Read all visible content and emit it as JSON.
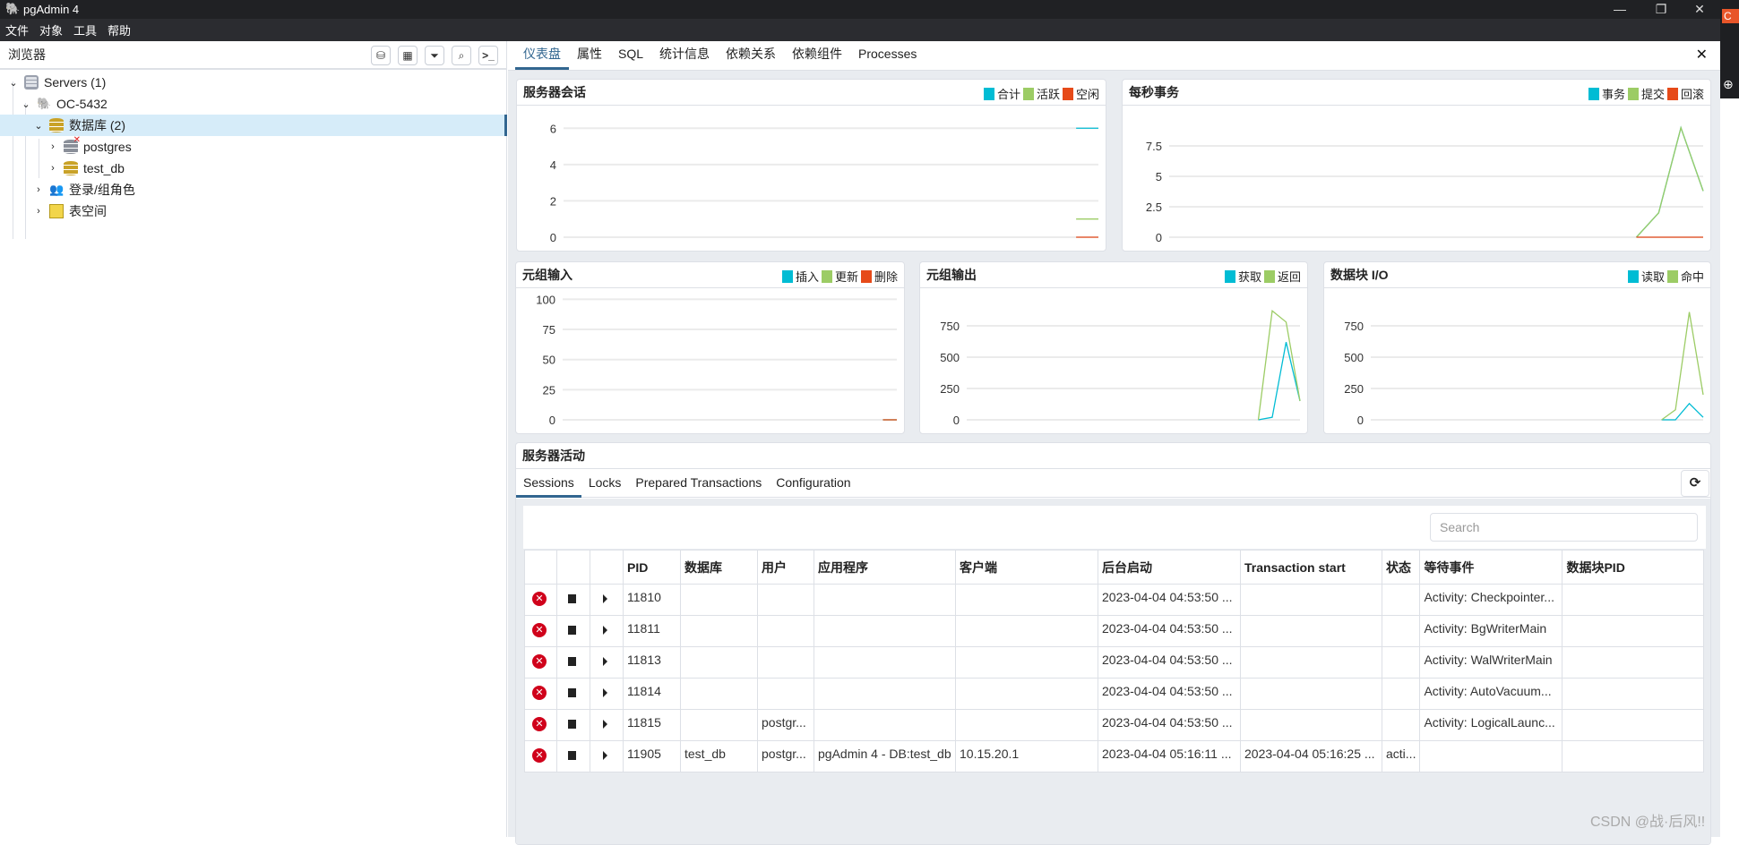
{
  "window": {
    "title": "pgAdmin 4",
    "minimize": "—",
    "maximize": "❐",
    "close": "✕"
  },
  "menu": [
    "文件",
    "对象",
    "工具",
    "帮助"
  ],
  "browser": {
    "title": "浏览器",
    "toolbar": [
      "query-tool",
      "view-data",
      "filtered-rows",
      "search-objects",
      "psql-tool"
    ],
    "tree": [
      {
        "label": "Servers (1)",
        "level": 0,
        "expanded": true,
        "icon": "servers-icon"
      },
      {
        "label": "OC-5432",
        "level": 1,
        "expanded": true,
        "icon": "elephant-icon"
      },
      {
        "label": "数据库 (2)",
        "level": 2,
        "expanded": true,
        "selected": true,
        "icon": "database-icon"
      },
      {
        "label": "postgres",
        "level": 3,
        "expanded": false,
        "icon": "database-disconnected-icon"
      },
      {
        "label": "test_db",
        "level": 3,
        "expanded": false,
        "icon": "database-icon"
      },
      {
        "label": "登录/组角色",
        "level": 2,
        "expanded": false,
        "icon": "roles-icon"
      },
      {
        "label": "表空间",
        "level": 2,
        "expanded": false,
        "icon": "tablespace-icon"
      }
    ]
  },
  "tabs": [
    "仪表盘",
    "属性",
    "SQL",
    "统计信息",
    "依赖关系",
    "依赖组件",
    "Processes"
  ],
  "active_tab": "仪表盘",
  "colors": {
    "cyan": "#00bcd4",
    "green": "#9ccc65",
    "red": "#e64a19",
    "accent": "#326690"
  },
  "chart_data": [
    {
      "type": "line",
      "title": "服务器会话",
      "xlim": [
        0,
        24
      ],
      "ylim": [
        0,
        6.9
      ],
      "yticks": [
        0,
        2,
        4,
        6
      ],
      "grid": true,
      "legend": "top-right",
      "x": [
        23,
        24
      ],
      "series": [
        {
          "name": "合计",
          "color": "#00bcd4",
          "values": [
            6,
            6
          ]
        },
        {
          "name": "活跃",
          "color": "#9ccc65",
          "values": [
            1,
            1
          ]
        },
        {
          "name": "空闲",
          "color": "#e64a19",
          "values": [
            0,
            0
          ]
        }
      ]
    },
    {
      "type": "line",
      "title": "每秒事务",
      "xlim": [
        0,
        24
      ],
      "ylim": [
        0,
        10.3
      ],
      "yticks": [
        0,
        2.5,
        5,
        7.5
      ],
      "grid": true,
      "legend": "top-right",
      "x": [
        21,
        22,
        23,
        24
      ],
      "series": [
        {
          "name": "事务",
          "color": "#00bcd4",
          "values": [
            0,
            2,
            9,
            3.8
          ]
        },
        {
          "name": "提交",
          "color": "#9ccc65",
          "values": [
            0,
            2,
            9,
            3.8
          ]
        },
        {
          "name": "回滚",
          "color": "#e64a19",
          "values": [
            0,
            0,
            0,
            0
          ]
        }
      ]
    },
    {
      "type": "line",
      "title": "元组输入",
      "xlim": [
        0,
        24
      ],
      "ylim": [
        0,
        104
      ],
      "yticks": [
        0,
        25,
        50,
        75,
        100
      ],
      "grid": true,
      "legend": "top-right",
      "x": [
        23,
        24
      ],
      "series": [
        {
          "name": "插入",
          "color": "#00bcd4",
          "values": [
            0,
            0
          ]
        },
        {
          "name": "更新",
          "color": "#9ccc65",
          "values": [
            0,
            0
          ]
        },
        {
          "name": "删除",
          "color": "#e64a19",
          "values": [
            0,
            0
          ]
        }
      ]
    },
    {
      "type": "line",
      "title": "元组输出",
      "xlim": [
        0,
        24
      ],
      "ylim": [
        0,
        1000
      ],
      "yticks": [
        0,
        250,
        500,
        750
      ],
      "grid": true,
      "legend": "top-right",
      "x": [
        21,
        22,
        23,
        24
      ],
      "series": [
        {
          "name": "获取",
          "color": "#00bcd4",
          "values": [
            0,
            20,
            620,
            150
          ]
        },
        {
          "name": "返回",
          "color": "#9ccc65",
          "values": [
            0,
            870,
            780,
            150
          ]
        }
      ]
    },
    {
      "type": "line",
      "title": "数据块 I/O",
      "xlim": [
        0,
        24
      ],
      "ylim": [
        0,
        1000
      ],
      "yticks": [
        0,
        250,
        500,
        750
      ],
      "grid": true,
      "legend": "top-right",
      "x": [
        21,
        22,
        23,
        24
      ],
      "series": [
        {
          "name": "读取",
          "color": "#00bcd4",
          "values": [
            0,
            0,
            130,
            20
          ]
        },
        {
          "name": "命中",
          "color": "#9ccc65",
          "values": [
            0,
            80,
            860,
            200
          ]
        }
      ]
    }
  ],
  "activity": {
    "title": "服务器活动",
    "tabs": [
      "Sessions",
      "Locks",
      "Prepared Transactions",
      "Configuration"
    ],
    "active_tab": "Sessions",
    "search_placeholder": "Search",
    "columns": [
      "",
      "",
      "",
      "PID",
      "数据库",
      "用户",
      "应用程序",
      "客户端",
      "后台启动",
      "Transaction start",
      "状态",
      "等待事件",
      "数据块PID"
    ],
    "rows": [
      [
        "11810",
        "",
        "",
        "",
        "",
        "2023-04-04 04:53:50 ...",
        "",
        "",
        "Activity: Checkpointer...",
        ""
      ],
      [
        "11811",
        "",
        "",
        "",
        "",
        "2023-04-04 04:53:50 ...",
        "",
        "",
        "Activity: BgWriterMain",
        ""
      ],
      [
        "11813",
        "",
        "",
        "",
        "",
        "2023-04-04 04:53:50 ...",
        "",
        "",
        "Activity: WalWriterMain",
        ""
      ],
      [
        "11814",
        "",
        "",
        "",
        "",
        "2023-04-04 04:53:50 ...",
        "",
        "",
        "Activity: AutoVacuum...",
        ""
      ],
      [
        "11815",
        "",
        "postgr...",
        "",
        "",
        "2023-04-04 04:53:50 ...",
        "",
        "",
        "Activity: LogicalLaunc...",
        ""
      ],
      [
        "11905",
        "test_db",
        "postgr...",
        "pgAdmin 4 - DB:test_db",
        "10.15.20.1",
        "2023-04-04 05:16:11 ...",
        "2023-04-04 05:16:25 ...",
        "acti...",
        "",
        ""
      ]
    ]
  },
  "watermark": "CSDN @战·后风!!"
}
